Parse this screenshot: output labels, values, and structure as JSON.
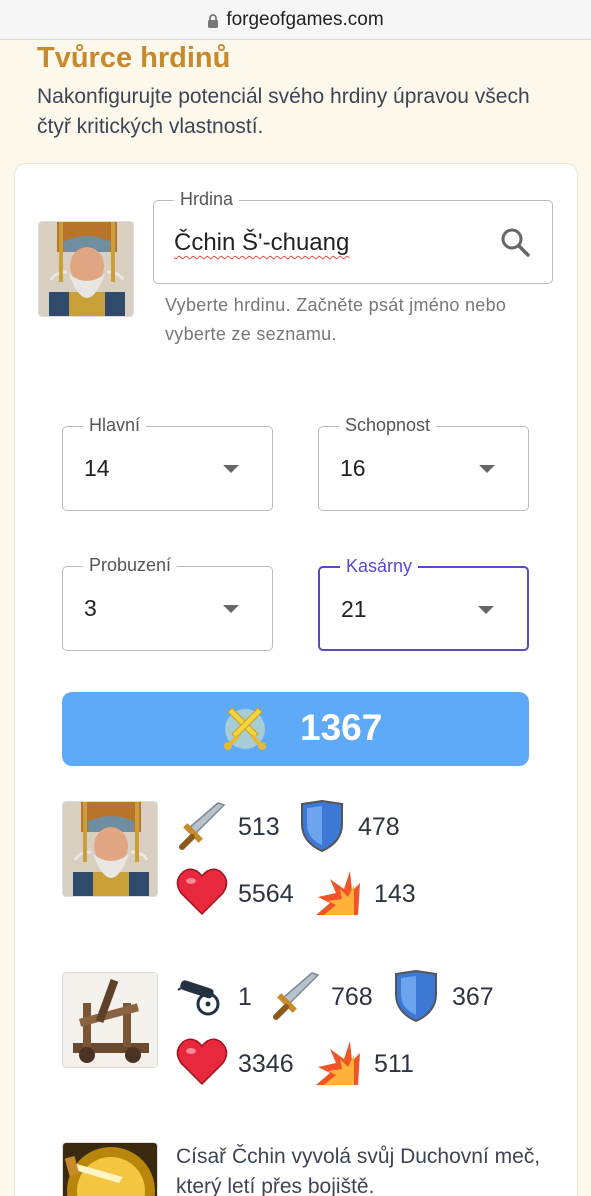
{
  "browser": {
    "url": "forgeofgames.com"
  },
  "page": {
    "title": "Tvůrce hrdinů",
    "subtitle": "Nakonfigurujte potenciál svého hrdiny úpravou všech čtyř kritických vlastností."
  },
  "hero_select": {
    "label": "Hrdina",
    "value": "Čchin Š'-chuang",
    "helper": "Vyberte hrdinu. Začněte psát jméno nebo vyberte ze seznamu."
  },
  "selects": {
    "main": {
      "label": "Hlavní",
      "value": "14"
    },
    "ability": {
      "label": "Schopnost",
      "value": "16"
    },
    "awakening": {
      "label": "Probuzení",
      "value": "3"
    },
    "barracks": {
      "label": "Kasárny",
      "value": "21"
    }
  },
  "power": {
    "value": "1367"
  },
  "hero_stats": {
    "attack": "513",
    "defense": "478",
    "health": "5564",
    "damage": "143"
  },
  "unit_stats": {
    "count": "1",
    "attack": "768",
    "defense": "367",
    "health": "3346",
    "damage": "511"
  },
  "ability_description": "Císař Čchin vyvolá svůj Duchovní meč, který letí přes bojiště."
}
